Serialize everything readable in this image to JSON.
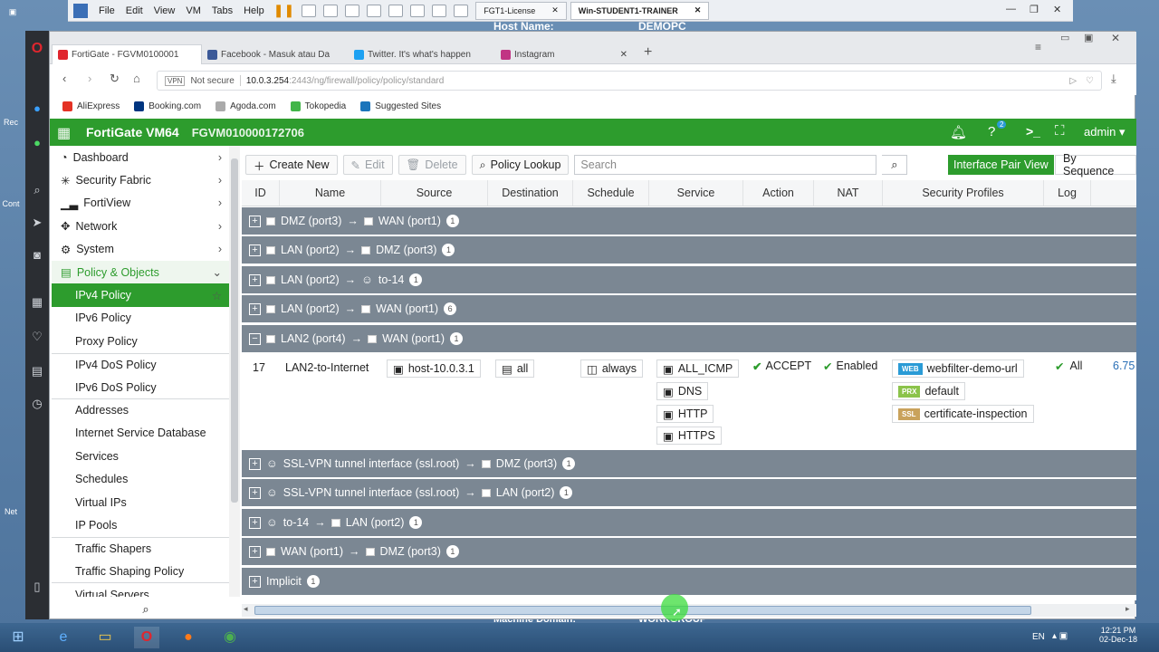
{
  "vm_window": {
    "menu": [
      "File",
      "Edit",
      "View",
      "VM",
      "Tabs",
      "Help"
    ],
    "tabs": [
      {
        "label": "FGT1-License"
      },
      {
        "label": "Win-STUDENT1-TRAINER"
      }
    ],
    "bg_labels": {
      "host_name": "Host Name:",
      "host_value": "DEMOPC",
      "machine_domain": "Machine Domain:",
      "workgroup": "WORKGROUP"
    }
  },
  "browser": {
    "tabs": [
      {
        "label": "FortiGate - FGVM0100001"
      },
      {
        "label": "Facebook - Masuk atau Da"
      },
      {
        "label": "Twitter. It's what's happen"
      },
      {
        "label": "Instagram"
      }
    ],
    "address": {
      "vpn": "VPN",
      "security": "Not secure",
      "url_host": "10.0.3.254",
      "url_path": ":2443/ng/firewall/policy/policy/standard"
    },
    "bookmarks": [
      "AliExpress",
      "Booking.com",
      "Agoda.com",
      "Tokopedia",
      "Suggested Sites"
    ]
  },
  "fortigate": {
    "product": "FortiGate VM64",
    "serial": "FGVM010000172706",
    "notification_count": "2",
    "user": "admin",
    "nav": [
      {
        "label": "Dashboard",
        "icon": "dashboard-icon",
        "type": "top"
      },
      {
        "label": "Security Fabric",
        "icon": "fabric-icon",
        "type": "top"
      },
      {
        "label": "FortiView",
        "icon": "chart-icon",
        "type": "top"
      },
      {
        "label": "Network",
        "icon": "network-icon",
        "type": "top"
      },
      {
        "label": "System",
        "icon": "gear-icon",
        "type": "top"
      },
      {
        "label": "Policy & Objects",
        "icon": "policy-icon",
        "type": "section"
      },
      {
        "label": "IPv4 Policy",
        "type": "active"
      },
      {
        "label": "IPv6 Policy",
        "type": "sub"
      },
      {
        "label": "Proxy Policy",
        "type": "sub"
      },
      {
        "label": "IPv4 DoS Policy",
        "type": "sub"
      },
      {
        "label": "IPv6 DoS Policy",
        "type": "sub"
      },
      {
        "label": "Addresses",
        "type": "sub"
      },
      {
        "label": "Internet Service Database",
        "type": "sub"
      },
      {
        "label": "Services",
        "type": "sub"
      },
      {
        "label": "Schedules",
        "type": "sub"
      },
      {
        "label": "Virtual IPs",
        "type": "sub"
      },
      {
        "label": "IP Pools",
        "type": "sub"
      },
      {
        "label": "Traffic Shapers",
        "type": "sub"
      },
      {
        "label": "Traffic Shaping Policy",
        "type": "sub"
      },
      {
        "label": "Virtual Servers",
        "type": "sub"
      }
    ],
    "toolbar": {
      "create_new": "Create New",
      "edit": "Edit",
      "delete": "Delete",
      "policy_lookup": "Policy Lookup",
      "search_placeholder": "Search",
      "interface_pair_view": "Interface Pair View",
      "by_sequence": "By Sequence"
    },
    "columns": [
      "ID",
      "Name",
      "Source",
      "Destination",
      "Schedule",
      "Service",
      "Action",
      "NAT",
      "Security Profiles",
      "Log"
    ],
    "groups_before": [
      {
        "from": "DMZ (port3)",
        "to": "WAN (port1)",
        "count": "1",
        "expanded": false
      },
      {
        "from": "LAN (port2)",
        "to": "DMZ (port3)",
        "count": "1",
        "expanded": false
      },
      {
        "from": "LAN (port2)",
        "to": "to-14",
        "count": "1",
        "expanded": false
      },
      {
        "from": "LAN (port2)",
        "to": "WAN (port1)",
        "count": "6",
        "expanded": false
      },
      {
        "from": "LAN2 (port4)",
        "to": "WAN (port1)",
        "count": "1",
        "expanded": true
      }
    ],
    "policy_row": {
      "id": "17",
      "name": "LAN2-to-Internet",
      "source": "host-10.0.3.1",
      "destination": "all",
      "schedule": "always",
      "services": [
        "ALL_ICMP",
        "DNS",
        "HTTP",
        "HTTPS"
      ],
      "action": "ACCEPT",
      "nat": "Enabled",
      "profiles": [
        {
          "tag": "WEB",
          "name": "webfilter-demo-url",
          "color": "#2a9bd6"
        },
        {
          "tag": "PRX",
          "name": "default",
          "color": "#8bc34a"
        },
        {
          "tag": "SSL",
          "name": "certificate-inspection",
          "color": "#c9a25b"
        }
      ],
      "log": "All",
      "bytes": "6.75"
    },
    "groups_after": [
      {
        "from": "SSL-VPN tunnel interface (ssl.root)",
        "to": "DMZ (port3)",
        "count": "1"
      },
      {
        "from": "SSL-VPN tunnel interface (ssl.root)",
        "to": "LAN (port2)",
        "count": "1"
      },
      {
        "from": "to-14",
        "to": "LAN (port2)",
        "count": "1"
      },
      {
        "from": "WAN (port1)",
        "to": "DMZ (port3)",
        "count": "1"
      }
    ],
    "implicit": {
      "label": "Implicit",
      "count": "1"
    }
  },
  "taskbar": {
    "lang": "EN",
    "time": "12:21 PM",
    "date": "02-Dec-18"
  },
  "colors": {
    "fortinet_green": "#2d9c2d",
    "group_row": "#7b8793"
  }
}
